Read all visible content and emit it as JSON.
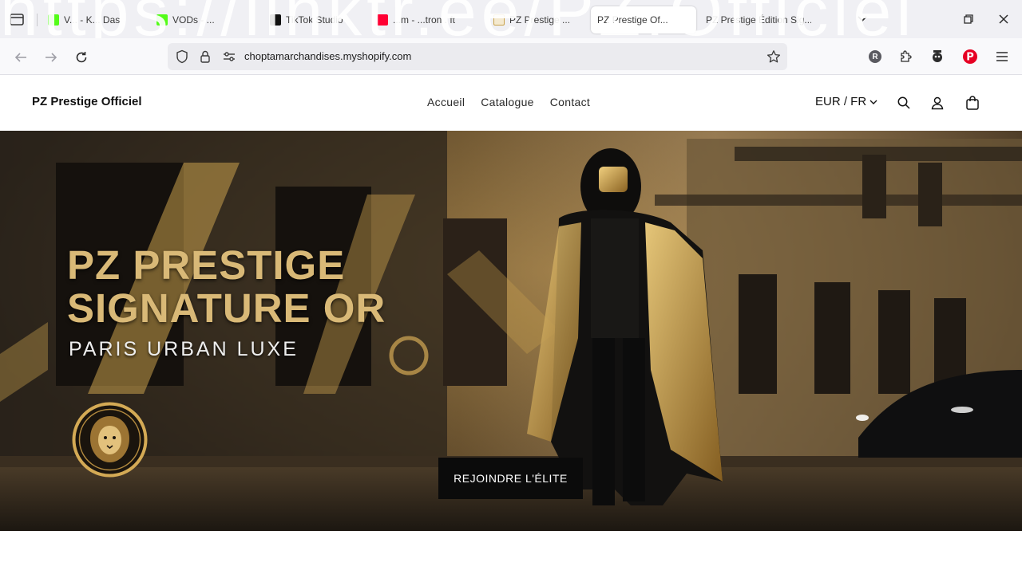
{
  "browser": {
    "watermark": "https://linktr.ee/PZ.Officiel",
    "tabs": [
      {
        "label": "V... - K... Das",
        "favicon_color": "#53fc18"
      },
      {
        "label": "VODs - ...",
        "favicon_color": "#53fc18"
      },
      {
        "label": "TikTok Studio",
        "favicon_color": "#111111"
      },
      {
        "label": "...m - ...tron . ft",
        "favicon_color": "#ff0033"
      },
      {
        "label": "PZ Prestige ...",
        "favicon_color": "#c9a24a"
      },
      {
        "label": "PZ Prestige Of...",
        "favicon_color": "#c9a24a"
      },
      {
        "label": "PZ Prestige Édition Sig...",
        "favicon_color": "#c9a24a"
      }
    ],
    "url": "choptamarchandises.myshopify.com",
    "extension_avatar_letter": "R",
    "colors": {
      "pinterest": "#e60023"
    }
  },
  "store": {
    "brand": "PZ Prestige Officiel",
    "menu": [
      "Accueil",
      "Catalogue",
      "Contact"
    ],
    "currency": "EUR / FR"
  },
  "hero": {
    "title_line1": "PZ PRESTIGE",
    "title_line2": "SIGNATURE OR",
    "subtitle": "PARIS URBAN LUXE",
    "cta": "REJOINDRE L'ÉLITE",
    "colors": {
      "gold": "#d9b977",
      "button": "#0b0b0b"
    }
  }
}
